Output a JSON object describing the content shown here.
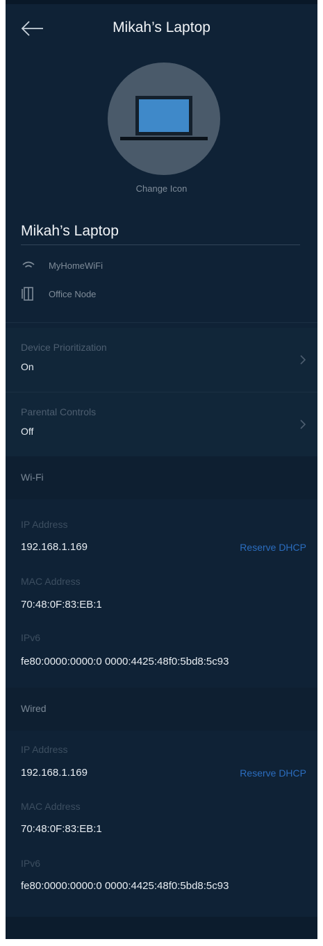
{
  "header": {
    "title": "Mikah’s Laptop"
  },
  "icon": {
    "change_label": "Change Icon"
  },
  "device": {
    "name": "Mikah’s Laptop",
    "network": "MyHomeWiFi",
    "node": "Office Node"
  },
  "settings": [
    {
      "label": "Device Prioritization",
      "value": "On"
    },
    {
      "label": "Parental Controls",
      "value": "Off"
    }
  ],
  "wifi": {
    "section_label": "Wi-Fi",
    "ip_label": "IP Address",
    "ip_value": "192.168.1.169",
    "reserve_label": "Reserve DHCP",
    "mac_label": "MAC Address",
    "mac_value": "70:48:0F:83:EB:1",
    "ipv6_label": "IPv6",
    "ipv6_value": "fe80:0000:0000:0 0000:4425:48f0:5bd8:5c93"
  },
  "wired": {
    "section_label": "Wired",
    "ip_label": "IP Address",
    "ip_value": "192.168.1.169",
    "reserve_label": "Reserve DHCP",
    "mac_label": "MAC Address",
    "mac_value": "70:48:0F:83:EB:1",
    "ipv6_label": "IPv6",
    "ipv6_value": "fe80:0000:0000:0 0000:4425:48f0:5bd8:5c93"
  },
  "colors": {
    "background": "#0f2236",
    "link": "#2b6dbf",
    "muted_text": "#7f8c99"
  },
  "icons": [
    "back-arrow-icon",
    "laptop-icon",
    "wifi-icon",
    "node-icon",
    "chevron-right-icon"
  ]
}
